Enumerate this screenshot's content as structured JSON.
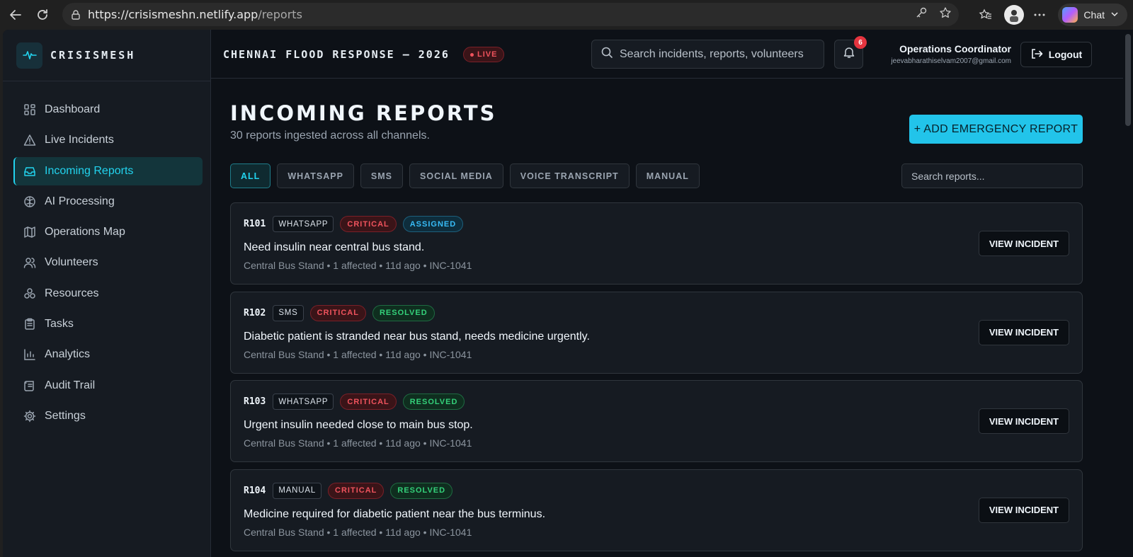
{
  "browser": {
    "url_host": "https://crisismeshn.netlify.app",
    "url_path": "/reports",
    "chat_label": "Chat"
  },
  "brand": {
    "name": "CRISISMESH",
    "accent": "#22d3ee"
  },
  "sidebar": {
    "items": [
      {
        "label": "Dashboard",
        "icon": "grid-icon",
        "active": false
      },
      {
        "label": "Live Incidents",
        "icon": "alert-triangle-icon",
        "active": false
      },
      {
        "label": "Incoming Reports",
        "icon": "inbox-icon",
        "active": true
      },
      {
        "label": "AI Processing",
        "icon": "brain-icon",
        "active": false
      },
      {
        "label": "Operations Map",
        "icon": "map-icon",
        "active": false
      },
      {
        "label": "Volunteers",
        "icon": "users-icon",
        "active": false
      },
      {
        "label": "Resources",
        "icon": "boxes-icon",
        "active": false
      },
      {
        "label": "Tasks",
        "icon": "clipboard-icon",
        "active": false
      },
      {
        "label": "Analytics",
        "icon": "bar-chart-icon",
        "active": false
      },
      {
        "label": "Audit Trail",
        "icon": "scroll-icon",
        "active": false
      },
      {
        "label": "Settings",
        "icon": "gear-icon",
        "active": false
      }
    ]
  },
  "topbar": {
    "event_title": "CHENNAI FLOOD RESPONSE — 2026",
    "live_label": "LIVE",
    "search_placeholder": "Search incidents, reports, volunteers",
    "notification_count": "6",
    "user_role": "Operations Coordinator",
    "user_email": "jeevabharathiselvam2007@gmail.com",
    "logout_label": "Logout"
  },
  "page": {
    "title": "INCOMING REPORTS",
    "subtitle": "30 reports ingested across all channels.",
    "add_button": "+ ADD EMERGENCY REPORT",
    "filters": [
      "ALL",
      "WHATSAPP",
      "SMS",
      "SOCIAL MEDIA",
      "VOICE TRANSCRIPT",
      "MANUAL"
    ],
    "active_filter": "ALL",
    "search_placeholder": "Search reports..."
  },
  "reports": [
    {
      "id": "R101",
      "channel": "WHATSAPP",
      "severity": "CRITICAL",
      "status": "ASSIGNED",
      "text": "Need insulin near central bus stand.",
      "meta": "Central Bus Stand • 1 affected • 11d ago • INC-1041",
      "action": "VIEW INCIDENT"
    },
    {
      "id": "R102",
      "channel": "SMS",
      "severity": "CRITICAL",
      "status": "RESOLVED",
      "text": "Diabetic patient is stranded near bus stand, needs medicine urgently.",
      "meta": "Central Bus Stand • 1 affected • 11d ago • INC-1041",
      "action": "VIEW INCIDENT"
    },
    {
      "id": "R103",
      "channel": "WHATSAPP",
      "severity": "CRITICAL",
      "status": "RESOLVED",
      "text": "Urgent insulin needed close to main bus stop.",
      "meta": "Central Bus Stand • 1 affected • 11d ago • INC-1041",
      "action": "VIEW INCIDENT"
    },
    {
      "id": "R104",
      "channel": "MANUAL",
      "severity": "CRITICAL",
      "status": "RESOLVED",
      "text": "Medicine required for diabetic patient near the bus terminus.",
      "meta": "Central Bus Stand • 1 affected • 11d ago • INC-1041",
      "action": "VIEW INCIDENT"
    }
  ]
}
